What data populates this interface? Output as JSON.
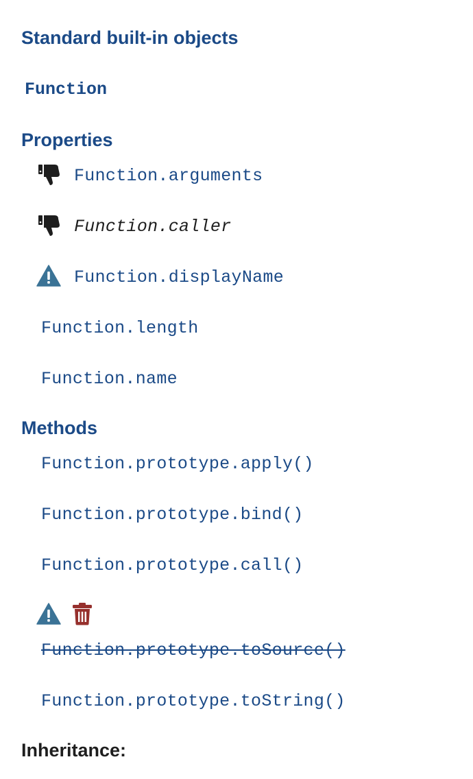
{
  "nav": {
    "section_title": "Standard built-in objects",
    "object_title": "Function",
    "properties_heading": "Properties",
    "properties": [
      {
        "label": "Function.arguments",
        "icons": [
          "thumbs-down-icon"
        ]
      },
      {
        "label": "Function.caller",
        "icons": [
          "thumbs-down-icon"
        ]
      },
      {
        "label": "Function.displayName",
        "icons": [
          "warning-icon"
        ]
      },
      {
        "label": "Function.length",
        "icons": []
      },
      {
        "label": "Function.name",
        "icons": []
      }
    ],
    "methods_heading": "Methods",
    "methods": [
      {
        "label": "Function.prototype.apply()",
        "icons": []
      },
      {
        "label": "Function.prototype.bind()",
        "icons": []
      },
      {
        "label": "Function.prototype.call()",
        "icons": []
      },
      {
        "label": "Function.prototype.toSource()",
        "icons": [
          "warning-icon",
          "trash-icon"
        ]
      },
      {
        "label": "Function.prototype.toString()",
        "icons": []
      }
    ],
    "inheritance_heading": "Inheritance:"
  },
  "colors": {
    "link": "#1b4a87",
    "warning": "#3b7396",
    "deprecated": "#96302d",
    "thumbs_down": "#1e1e1e"
  }
}
